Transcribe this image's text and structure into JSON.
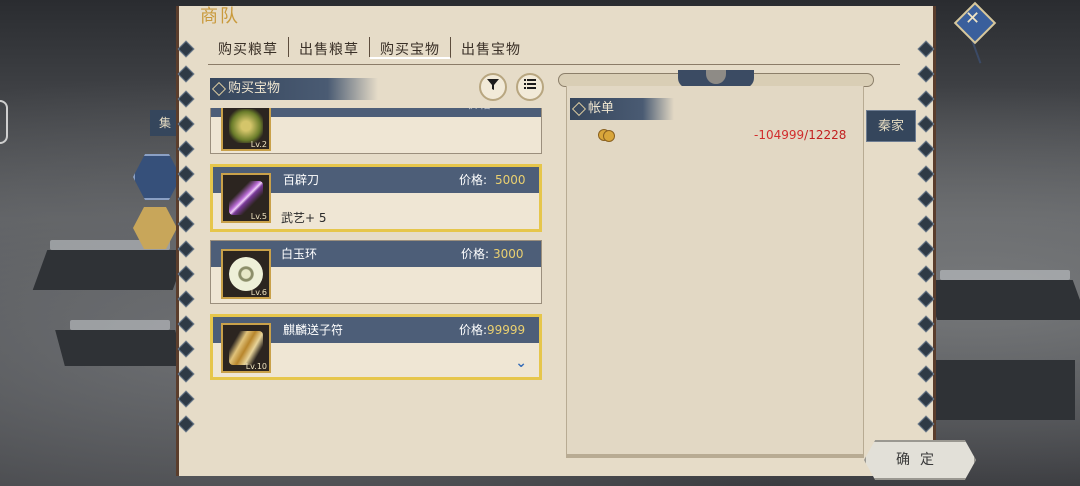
{
  "window": {
    "title": "商队"
  },
  "tabs": [
    {
      "label": "购买粮草",
      "active": false
    },
    {
      "label": "出售粮草",
      "active": false
    },
    {
      "label": "购买宝物",
      "active": true
    },
    {
      "label": "出售宝物",
      "active": false
    }
  ],
  "side": {
    "left_tab": "集",
    "right_tab": "秦家"
  },
  "section": {
    "title": "购买宝物",
    "filter_icon": "filter-icon",
    "list_icon": "list-icon"
  },
  "items": [
    {
      "name": "",
      "price_label": "价格:",
      "price": "",
      "level": "Lv.2",
      "effect": "",
      "selected": false,
      "icon": "armor-icon"
    },
    {
      "name": "百辟刀",
      "price_label": "价格:",
      "price": "5000",
      "level": "Lv.5",
      "effect": "武艺+ 5",
      "selected": true,
      "icon": "blade-icon"
    },
    {
      "name": "白玉环",
      "price_label": "价格:",
      "price": "3000",
      "level": "Lv.6",
      "effect": "",
      "selected": false,
      "icon": "jade-ring-icon"
    },
    {
      "name": "麒麟送子符",
      "price_label": "价格:",
      "price": "99999",
      "level": "Lv.10",
      "effect": "",
      "selected": true,
      "icon": "talisman-icon"
    }
  ],
  "ledger": {
    "title": "帐单",
    "coin_icon": "coins-icon",
    "balance": "-104999",
    "separator": "/",
    "total": "12228"
  },
  "confirm": {
    "label": "确定"
  },
  "colors": {
    "accent_gold": "#e6c64b",
    "header_blue": "#4d5e78",
    "negative_red": "#d22d2d",
    "price_gold": "#ead070"
  }
}
